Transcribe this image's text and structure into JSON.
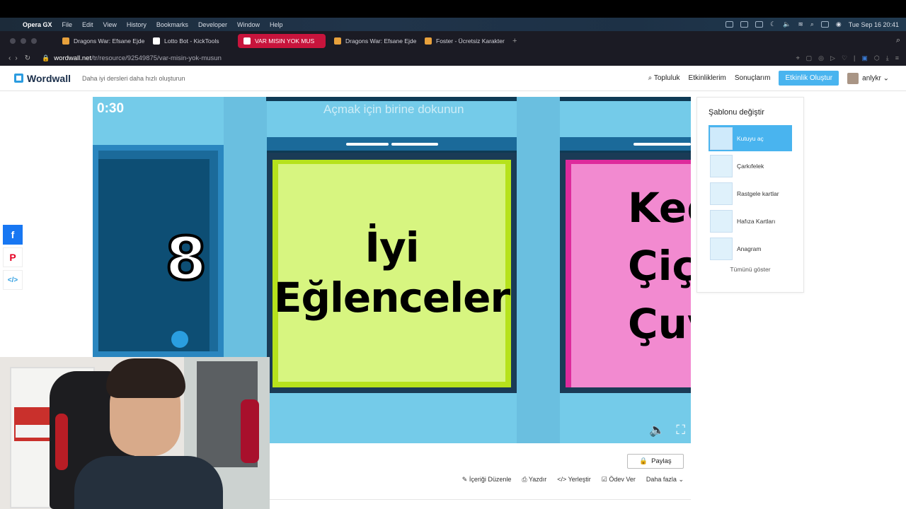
{
  "menubar": {
    "app": "Opera GX",
    "items": [
      "File",
      "Edit",
      "View",
      "History",
      "Bookmarks",
      "Developer",
      "Window",
      "Help"
    ],
    "clock": "Tue Sep 16  20:41"
  },
  "tabs": [
    {
      "label": "Dragons War: Efsane Ejde",
      "active": false
    },
    {
      "label": "Lotto Bot - KickTools",
      "active": false
    },
    {
      "label": "VAR MISIN YOK MUS",
      "active": true
    },
    {
      "label": "Dragons War: Efsane Ejde",
      "active": false
    },
    {
      "label": "Foster - Ücretsiz Karakter",
      "active": false
    }
  ],
  "address": {
    "host": "wordwall.net",
    "path": "/tr/resource/92549875/var-misin-yok-musun"
  },
  "header": {
    "logo": "Wordwall",
    "tagline": "Daha iyi dersleri daha hızlı oluşturun",
    "nav": {
      "community": "Topluluk",
      "activities": "Etkinliklerim",
      "results": "Sonuçlarım",
      "create": "Etkinlik Oluştur",
      "user": "anlykr"
    }
  },
  "game": {
    "timer": "0:30",
    "hint": "Açmak için birine dokunun",
    "left_card": "8",
    "center_card": [
      "İyi",
      "Eğlenceler"
    ],
    "right_card": [
      "Ked",
      "Çiçe",
      "Çuv"
    ],
    "colors": {
      "bg": "#74cbe9",
      "center_face": "#d7f580",
      "right_face": "#f28ad0"
    }
  },
  "templates": {
    "title": "Şablonu değiştir",
    "items": [
      {
        "label": "Kutuyu aç",
        "active": true
      },
      {
        "label": "Çarkıfelek",
        "active": false
      },
      {
        "label": "Rastgele kartlar",
        "active": false
      },
      {
        "label": "Hafıza Kartları",
        "active": false
      },
      {
        "label": "Anagram",
        "active": false
      }
    ],
    "show_all": "Tümünü göster"
  },
  "actions": {
    "share": "Paylaş",
    "edit": "İçeriği Düzenle",
    "print": "Yazdır",
    "embed": "Yerleştir",
    "assign": "Ödev Ver",
    "more": "Daha fazla"
  }
}
